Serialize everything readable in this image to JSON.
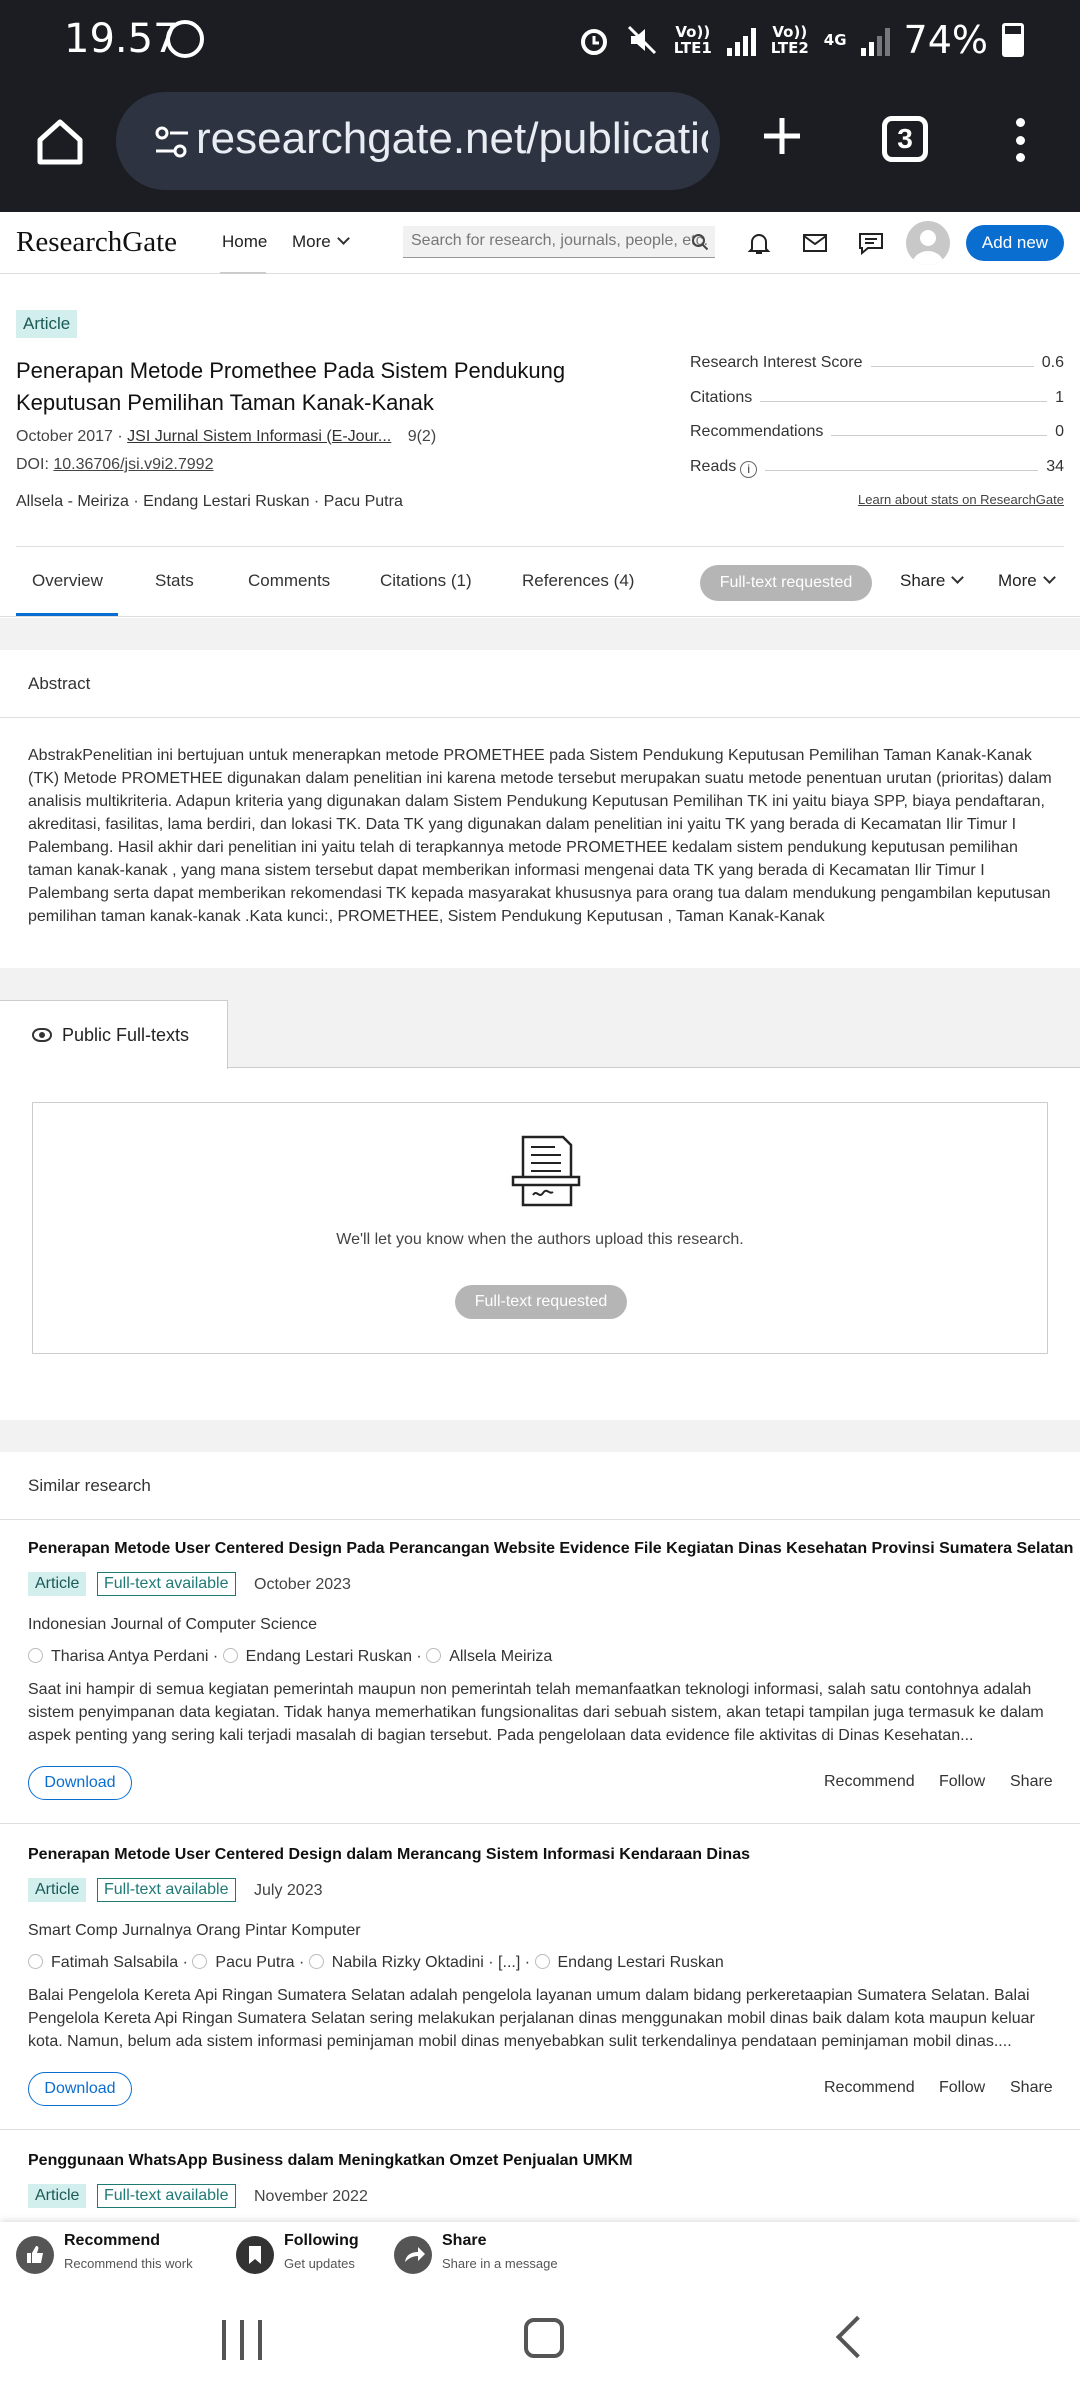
{
  "statusbar": {
    "time": "19.57",
    "battery": "74%",
    "sim1": "Vo)) LTE1",
    "sim2": "Vo)) LTE2",
    "net": "4G"
  },
  "browser": {
    "url": "researchgate.net/publication",
    "tab_count": "3"
  },
  "rg_nav": {
    "logo": "ResearchGate",
    "home": "Home",
    "more": "More",
    "search_placeholder": "Search for research, journals, people, etc.",
    "add_new": "Add new"
  },
  "article": {
    "badge": "Article",
    "title": "Penerapan Metode Promethee Pada Sistem Pendukung Keputusan Pemilihan Taman Kanak-Kanak",
    "date": "October 2017 · ",
    "journal": "JSI Jurnal Sistem Informasi (E-Jour...",
    "volume": "9(2)",
    "doi_label": "DOI: ",
    "doi": "10.36706/jsi.v9i2.7992",
    "authors": "Allsela - Meiriza · Endang Lestari Ruskan · Pacu Putra"
  },
  "stats": [
    {
      "label": "Research Interest Score",
      "value": "0.6"
    },
    {
      "label": "Citations",
      "value": "1"
    },
    {
      "label": "Recommendations",
      "value": "0"
    },
    {
      "label": "Reads",
      "value": "34"
    }
  ],
  "learn_link": "Learn about stats on ResearchGate",
  "tabs": {
    "overview": "Overview",
    "stats": "Stats",
    "comments": "Comments",
    "citations": "Citations (1)",
    "references": "References (4)",
    "fulltext_requested": "Full-text requested",
    "share": "Share",
    "more": "More"
  },
  "abstract": {
    "heading": "Abstract",
    "text": "AbstrakPenelitian ini bertujuan untuk menerapkan metode PROMETHEE pada Sistem Pendukung Keputusan Pemilihan Taman Kanak-Kanak (TK) Metode PROMETHEE digunakan dalam penelitian ini karena metode tersebut merupakan suatu metode penentuan urutan (prioritas) dalam analisis multikriteria. Adapun kriteria yang digunakan dalam Sistem Pendukung Keputusan Pemilihan TK ini yaitu biaya SPP, biaya pendaftaran, akreditasi, fasilitas, lama berdiri, dan lokasi TK. Data TK yang digunakan dalam penelitian ini yaitu TK yang berada di Kecamatan Ilir Timur I Palembang. Hasil akhir dari penelitian ini yaitu telah di terapkannya metode PROMETHEE kedalam sistem pendukung keputusan pemilihan taman kanak-kanak , yang mana sistem tersebut dapat memberikan informasi mengenai data TK yang berada di Kecamatan Ilir Timur I Palembang serta dapat memberikan rekomendasi TK kepada masyarakat khususnya para orang tua dalam mendukung pengambilan keputusan pemilihan taman kanak-kanak .Kata kunci:, PROMETHEE, Sistem Pendukung Keputusan , Taman Kanak-Kanak"
  },
  "fulltexts": {
    "tab": "Public Full-texts",
    "message": "We'll let you know when the authors upload this research.",
    "button": "Full-text requested"
  },
  "similar": {
    "heading": "Similar research",
    "items": [
      {
        "title": "Penerapan Metode User Centered Design Pada Perancangan Website Evidence File Kegiatan Dinas Kesehatan Provinsi Sumatera Selatan",
        "type": "Article",
        "availability": "Full-text available",
        "date": "October 2023",
        "journal": "Indonesian Journal of Computer Science",
        "authors": [
          "Tharisa Antya Perdani",
          "Endang Lestari Ruskan",
          "Allsela Meiriza"
        ],
        "abstract": "Saat ini hampir di semua kegiatan pemerintah maupun non pemerintah telah memanfaatkan teknologi informasi, salah satu contohnya adalah sistem penyimpanan data kegiatan. Tidak hanya memerhatikan fungsionalitas dari sebuah sistem, akan tetapi tampilan juga termasuk ke dalam aspek penting yang sering kali terjadi masalah di bagian tersebut. Pada pengelolaan data evidence file aktivitas di Dinas Kesehatan...",
        "download": "Download",
        "recommend": "Recommend",
        "follow": "Follow",
        "share": "Share"
      },
      {
        "title": "Penerapan Metode User Centered Design dalam Merancang Sistem Informasi Kendaraan Dinas",
        "type": "Article",
        "availability": "Full-text available",
        "date": "July 2023",
        "journal": "Smart Comp Jurnalnya Orang Pintar Komputer",
        "authors": [
          "Fatimah Salsabila",
          "Pacu Putra",
          "Nabila Rizky Oktadini",
          "[...]",
          "Endang Lestari Ruskan"
        ],
        "abstract": "Balai Pengelola Kereta Api Ringan Sumatera Selatan adalah pengelola layanan umum dalam bidang perkeretaapian Sumatera Selatan. Balai Pengelola Kereta Api Ringan Sumatera Selatan sering melakukan perjalanan dinas menggunakan mobil dinas baik dalam kota maupun keluar kota. Namun, belum ada sistem informasi peminjaman mobil dinas menyebabkan sulit terkendalinya pendataan peminjaman mobil dinas....",
        "download": "Download",
        "recommend": "Recommend",
        "follow": "Follow",
        "share": "Share"
      },
      {
        "title": "Penggunaan WhatsApp Business dalam Meningkatkan Omzet Penjualan UMKM",
        "type": "Article",
        "availability": "Full-text available",
        "date": "November 2022"
      }
    ]
  },
  "bottom_actions": [
    {
      "title": "Recommend",
      "sub": "Recommend this work"
    },
    {
      "title": "Following",
      "sub": "Get updates"
    },
    {
      "title": "Share",
      "sub": "Share in a message"
    }
  ],
  "colors": {
    "accent": "#0a6ed1",
    "badge_bg": "#d2efee",
    "badge_text": "#1b5a57",
    "chrome_bg": "#1b1d22"
  }
}
